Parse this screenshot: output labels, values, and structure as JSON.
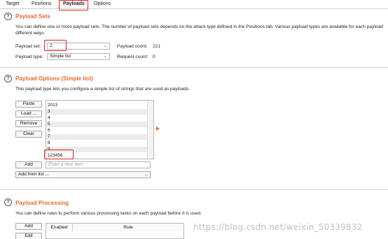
{
  "tabs": [
    {
      "label": "Target"
    },
    {
      "label": "Positions"
    },
    {
      "label": "Payloads"
    },
    {
      "label": "Options"
    }
  ],
  "payload_sets": {
    "title": "Payload Sets",
    "description": "You can define one or more payload sets. The number of payload sets depends on the attack type defined in the Positions tab. Various payload types are available for each payload set, and each payload type can be customized in different ways.",
    "desc_line1": "You can define one or more payload sets. The number of payload sets depends on the attack type defined in the Positions tab. Various payload types are available for each payload",
    "desc_line2": "different ways.",
    "set_label": "Payload set:",
    "set_value": "2",
    "type_label": "Payload type:",
    "type_value": "Simple list",
    "count_label": "Payload count:",
    "count_value": "221",
    "request_label": "Request count:",
    "request_value": "0"
  },
  "payload_options": {
    "title": "Payload Options (Simple list)",
    "description": "This payload type lets you configure a simple list of strings that are used as payloads.",
    "buttons": {
      "paste": "Paste",
      "load": "Load ...",
      "remove": "Remove",
      "clear": "Clear",
      "add": "Add",
      "add_from_list": "Add from list ..."
    },
    "list_items": [
      "2013",
      "3",
      "4",
      "5",
      "6",
      "7",
      "8",
      "9",
      "123456"
    ],
    "new_item_placeholder": "Enter a new item"
  },
  "payload_processing": {
    "title": "Payload Processing",
    "description": "You can define rules to perform various processing tasks on each payload before it is used.",
    "buttons": {
      "add": "Add",
      "edit": "Edit"
    },
    "columns": [
      "Enabled",
      "Rule"
    ]
  },
  "watermark": "https://blog.csdn.net/weixin_50339832",
  "colors": {
    "accent": "#e8692e",
    "highlight": "#e32020"
  }
}
